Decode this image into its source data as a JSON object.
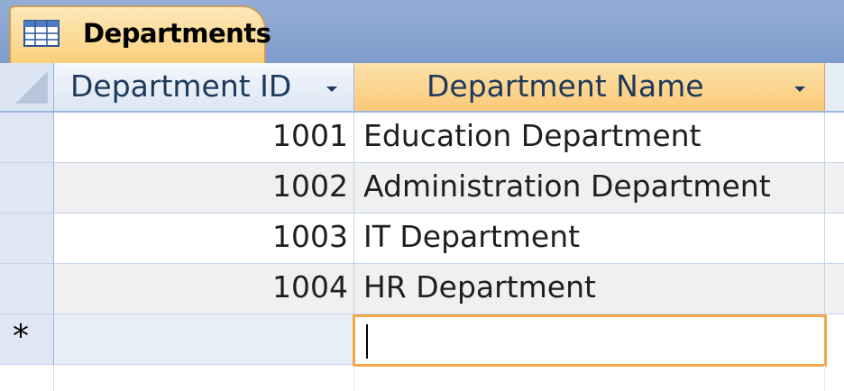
{
  "document_tab": {
    "label": "Departments",
    "icon": "table-icon"
  },
  "columns": [
    {
      "label": "Department ID"
    },
    {
      "label": "Department Name"
    }
  ],
  "rows": [
    {
      "id": "1001",
      "name": "Education Department"
    },
    {
      "id": "1002",
      "name": "Administration Department"
    },
    {
      "id": "1003",
      "name": "IT Department"
    },
    {
      "id": "1004",
      "name": "HR Department"
    }
  ],
  "new_record": {
    "marker": "*",
    "name_value": ""
  },
  "colors": {
    "active_header": "#fbc97a",
    "active_cell_border": "#f5a846",
    "header_text": "#1e395b"
  }
}
